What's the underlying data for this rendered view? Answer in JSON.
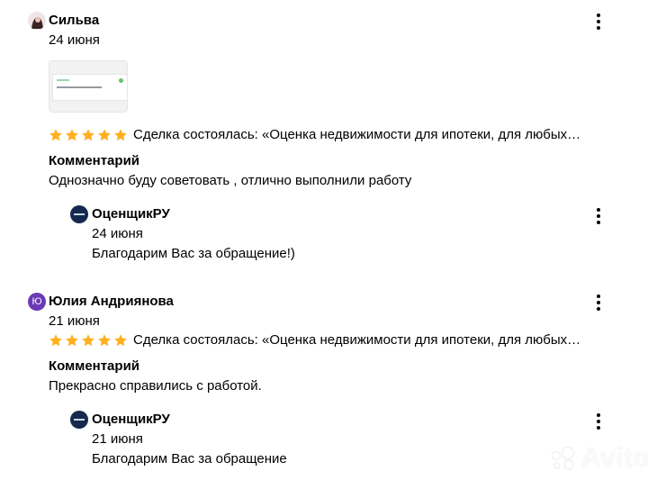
{
  "reviews": [
    {
      "author": "Сильва",
      "date": "24 июня",
      "has_photo": true,
      "rating": 5,
      "deal_text": "Сделка состоялась: «Оценка недвижимости для ипотеки, для любых…",
      "comment_label": "Комментарий",
      "comment": "Однозначно буду советовать , отлично выполнили работу",
      "reply": {
        "author": "ОценщикРУ",
        "date": "24 июня",
        "text": "Благодарим Вас за обращение!)"
      }
    },
    {
      "author": "Юлия Андриянова",
      "avatar_letter": "Ю",
      "date": "21 июня",
      "rating": 5,
      "deal_text": "Сделка состоялась: «Оценка недвижимости для ипотеки, для любых…",
      "comment_label": "Комментарий",
      "comment": "Прекрасно справились с работой.",
      "reply": {
        "author": "ОценщикРУ",
        "date": "21 июня",
        "text": "Благодарим Вас за обращение"
      }
    }
  ],
  "colors": {
    "star": "#ffb021",
    "avatar_letter_bg": "#6a3bb5",
    "seller_logo_bg": "#14294d"
  },
  "watermark": "Avito"
}
